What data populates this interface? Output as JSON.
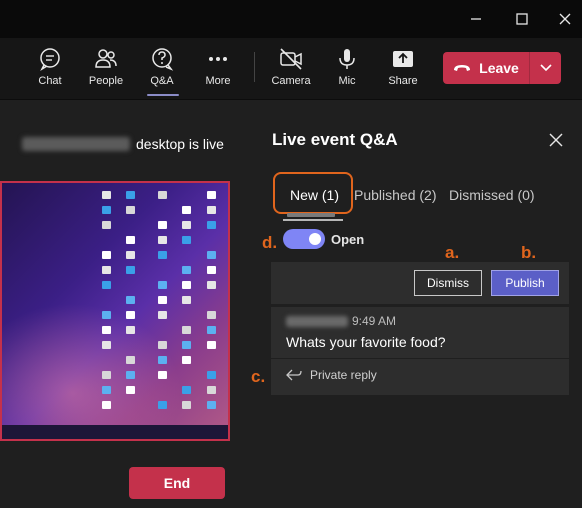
{
  "window": {
    "minimize_icon": "minimize-icon",
    "maximize_icon": "maximize-icon",
    "close_icon": "close-icon"
  },
  "toolbar": {
    "chat": "Chat",
    "people": "People",
    "qa": "Q&A",
    "more": "More",
    "camera": "Camera",
    "mic": "Mic",
    "share": "Share",
    "leave": "Leave"
  },
  "stage": {
    "presenter_suffix": "desktop is live",
    "end_label": "End"
  },
  "qa_panel": {
    "title": "Live event Q&A",
    "tabs": [
      {
        "label": "New (1)"
      },
      {
        "label": "Published (2)"
      },
      {
        "label": "Dismissed (0)"
      }
    ],
    "toggle_label": "Open",
    "dismiss_label": "Dismiss",
    "publish_label": "Publish",
    "question": {
      "time": "9:49 AM",
      "text": "Whats your favorite food?"
    },
    "private_reply_label": "Private reply"
  },
  "annotations": {
    "a": "a.",
    "b": "b.",
    "c": "c.",
    "d": "d."
  },
  "colors": {
    "accent": "#5b5fc7",
    "leave_red": "#c4314b",
    "annotation_orange": "#e0651d",
    "toggle_on": "#7f85f5"
  }
}
